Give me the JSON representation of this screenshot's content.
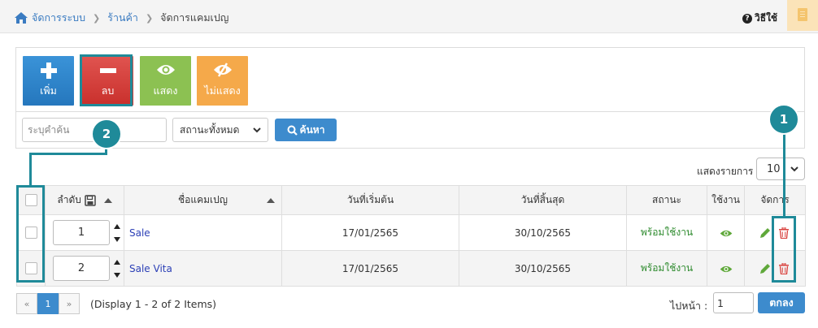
{
  "breadcrumb": {
    "items": [
      "จัดการระบบ",
      "ร้านค้า",
      "จัดการแคมเปญ"
    ]
  },
  "header": {
    "help_label": "วิธีใช้",
    "help_icon": "question-circle-icon",
    "note_icon": "notepad-icon"
  },
  "toolbar": {
    "add_label": "เพิ่ม",
    "delete_label": "ลบ",
    "show_label": "แสดง",
    "hide_label": "ไม่แสดง",
    "colors": {
      "add": "#2f86cc",
      "delete": "#d9413d",
      "show": "#8cc152",
      "hide": "#f5a94a"
    }
  },
  "search": {
    "placeholder": "ระบุคำค้น",
    "status_selected": "สถานะทั้งหมด",
    "button_label": "ค้นหา"
  },
  "per_page": {
    "label": "แสดงรายการ",
    "value": "10"
  },
  "table": {
    "headers": [
      "ลำดับ",
      "ชื่อแคมเปญ",
      "วันที่เริ่มต้น",
      "วันที่สิ้นสุด",
      "สถานะ",
      "ใช้งาน",
      "จัดการ"
    ],
    "rows": [
      {
        "order": "1",
        "name": "Sale",
        "start": "17/01/2565",
        "end": "30/10/2565",
        "status": "พร้อมใช้งาน"
      },
      {
        "order": "2",
        "name": "Sale Vita",
        "start": "17/01/2565",
        "end": "30/10/2565",
        "status": "พร้อมใช้งาน"
      }
    ]
  },
  "callouts": {
    "one": "1",
    "two": "2",
    "color": "#1f8a99"
  },
  "pagination": {
    "prev": "«",
    "current": "1",
    "next": "»",
    "display_text": "(Display 1 - 2 of 2 Items)",
    "goto_label": "ไปหน้า :",
    "goto_value": "1",
    "go_button": "ตกลง"
  }
}
